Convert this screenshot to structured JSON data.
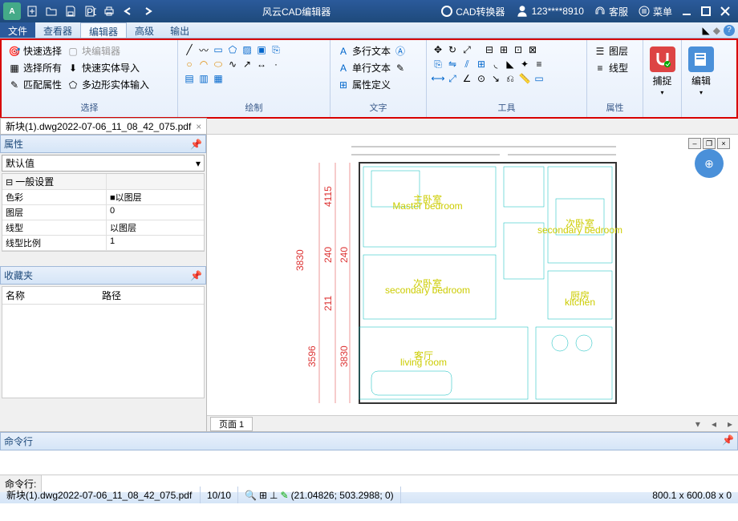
{
  "titlebar": {
    "app_title": "风云CAD编辑器",
    "cad_convert": "CAD转换器",
    "user": "123****8910",
    "support": "客服",
    "menu": "菜单"
  },
  "menutabs": {
    "file": "文件",
    "viewer": "查看器",
    "editor": "编辑器",
    "advanced": "高级",
    "output": "输出"
  },
  "ribbon": {
    "select": {
      "label": "选择",
      "quick_select": "快速选择",
      "select_all": "选择所有",
      "match_attr": "匹配属性",
      "block_editor": "块编辑器",
      "quick_entity_import": "快速实体导入",
      "polygon_entity_input": "多边形实体输入"
    },
    "draw": {
      "label": "绘制"
    },
    "text": {
      "label": "文字",
      "multiline": "多行文本",
      "singleline": "单行文本",
      "attr_def": "属性定义"
    },
    "tools": {
      "label": "工具"
    },
    "props": {
      "label": "属性",
      "layer": "图层",
      "linetype": "线型"
    },
    "snap": {
      "label": "捕捉"
    },
    "edit": {
      "label": "编辑"
    }
  },
  "filetab": {
    "name": "新块(1).dwg2022-07-06_11_08_42_075.pdf"
  },
  "proppanel": {
    "title": "属性",
    "default": "默认值",
    "general": "一般设置",
    "rows": [
      {
        "k": "色彩",
        "v": "■以图层"
      },
      {
        "k": "图层",
        "v": "0"
      },
      {
        "k": "线型",
        "v": "以图层"
      },
      {
        "k": "线型比例",
        "v": "1"
      }
    ]
  },
  "favorites": {
    "title": "收藏夹",
    "col_name": "名称",
    "col_path": "路径"
  },
  "rooms": {
    "master": "主卧室",
    "master_en": "Master bedroom",
    "second": "次卧室",
    "second_en": "secondary bedroom",
    "kitchen": "厨房",
    "kitchen_en": "kitchen",
    "living": "客厅",
    "living_en": "living room"
  },
  "dims": {
    "d1": "4115",
    "d2": "240",
    "d3": "3830",
    "d4": "211",
    "d5": "240",
    "d6": "3830",
    "d7": "3596"
  },
  "pagebar": {
    "page1": "页面 1"
  },
  "cmd": {
    "title": "命令行",
    "prompt": "命令行:"
  },
  "status": {
    "file": "新块(1).dwg2022-07-06_11_08_42_075.pdf",
    "pages": "10/10",
    "coords": "(21.04826; 503.2988; 0)",
    "dims": "800.1 x 600.08 x 0"
  }
}
